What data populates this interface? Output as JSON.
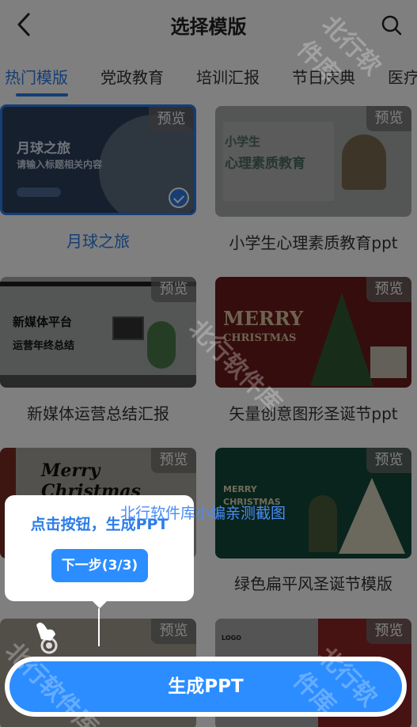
{
  "header": {
    "title": "选择模版",
    "back_icon": "chevron-left-icon",
    "search_icon": "search-icon"
  },
  "tabs": [
    {
      "label": "热门模版",
      "active": true
    },
    {
      "label": "党政教育",
      "active": false
    },
    {
      "label": "培训汇报",
      "active": false
    },
    {
      "label": "节日庆典",
      "active": false
    },
    {
      "label": "医疗",
      "active": false
    }
  ],
  "templates": [
    {
      "caption": "月球之旅",
      "preview": "预览",
      "selected": true,
      "thumb_title": "月球之旅",
      "thumb_sub": "请输入标题相关内容"
    },
    {
      "caption": "小学生心理素质教育ppt",
      "preview": "预览",
      "selected": false,
      "thumb_title": "小学生",
      "thumb_sub": "心理素质教育"
    },
    {
      "caption": "新媒体运营总结汇报",
      "preview": "预览",
      "selected": false,
      "thumb_title": "新媒体平台",
      "thumb_sub": "运营年终总结"
    },
    {
      "caption": "矢量创意图形圣诞节ppt",
      "preview": "预览",
      "selected": false,
      "thumb_title": "MERRY",
      "thumb_sub": "CHRISTMAS"
    },
    {
      "caption": "",
      "preview": "预览",
      "selected": false,
      "thumb_title": "Merry Christmas",
      "thumb_sub": ""
    },
    {
      "caption": "绿色扁平风圣诞节模版",
      "preview": "预览",
      "selected": false,
      "thumb_title": "MERRY",
      "thumb_sub": "CHRISTMAS"
    },
    {
      "caption": "",
      "preview": "预览",
      "selected": false,
      "thumb_title": "",
      "thumb_sub": ""
    },
    {
      "caption": "",
      "preview": "预览",
      "selected": false,
      "thumb_title": "LOGO",
      "thumb_sub": ""
    }
  ],
  "tooltip": {
    "text": "点击按钮，生成PPT",
    "next_label": "下一步(3/3)"
  },
  "generate_button": {
    "label": "生成PPT"
  },
  "watermark": {
    "text": "北行软件库",
    "caption": "北行软件库小编亲测截图"
  },
  "colors": {
    "accent": "#2b7de9",
    "button": "#2b8dff"
  }
}
